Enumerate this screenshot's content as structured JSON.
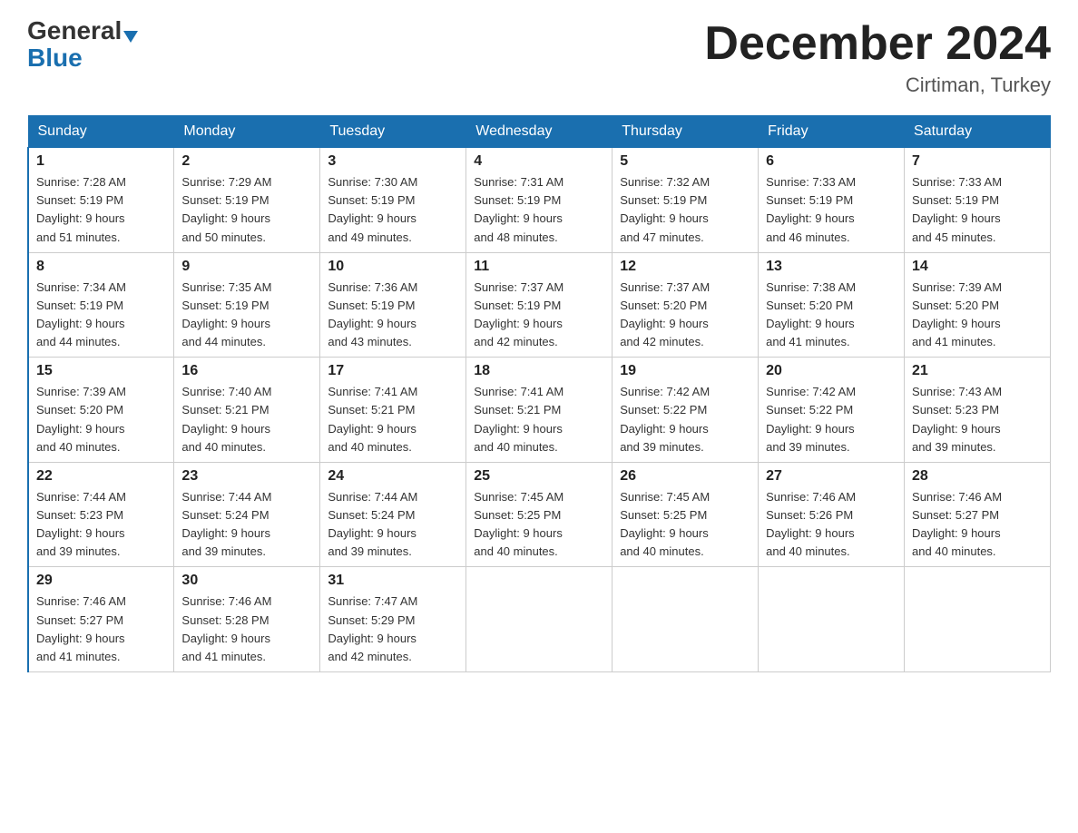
{
  "header": {
    "logo_general": "General",
    "logo_blue": "Blue",
    "month_title": "December 2024",
    "location": "Cirtiman, Turkey"
  },
  "weekdays": [
    "Sunday",
    "Monday",
    "Tuesday",
    "Wednesday",
    "Thursday",
    "Friday",
    "Saturday"
  ],
  "weeks": [
    [
      {
        "day": "1",
        "sunrise": "7:28 AM",
        "sunset": "5:19 PM",
        "daylight": "9 hours and 51 minutes."
      },
      {
        "day": "2",
        "sunrise": "7:29 AM",
        "sunset": "5:19 PM",
        "daylight": "9 hours and 50 minutes."
      },
      {
        "day": "3",
        "sunrise": "7:30 AM",
        "sunset": "5:19 PM",
        "daylight": "9 hours and 49 minutes."
      },
      {
        "day": "4",
        "sunrise": "7:31 AM",
        "sunset": "5:19 PM",
        "daylight": "9 hours and 48 minutes."
      },
      {
        "day": "5",
        "sunrise": "7:32 AM",
        "sunset": "5:19 PM",
        "daylight": "9 hours and 47 minutes."
      },
      {
        "day": "6",
        "sunrise": "7:33 AM",
        "sunset": "5:19 PM",
        "daylight": "9 hours and 46 minutes."
      },
      {
        "day": "7",
        "sunrise": "7:33 AM",
        "sunset": "5:19 PM",
        "daylight": "9 hours and 45 minutes."
      }
    ],
    [
      {
        "day": "8",
        "sunrise": "7:34 AM",
        "sunset": "5:19 PM",
        "daylight": "9 hours and 44 minutes."
      },
      {
        "day": "9",
        "sunrise": "7:35 AM",
        "sunset": "5:19 PM",
        "daylight": "9 hours and 44 minutes."
      },
      {
        "day": "10",
        "sunrise": "7:36 AM",
        "sunset": "5:19 PM",
        "daylight": "9 hours and 43 minutes."
      },
      {
        "day": "11",
        "sunrise": "7:37 AM",
        "sunset": "5:19 PM",
        "daylight": "9 hours and 42 minutes."
      },
      {
        "day": "12",
        "sunrise": "7:37 AM",
        "sunset": "5:20 PM",
        "daylight": "9 hours and 42 minutes."
      },
      {
        "day": "13",
        "sunrise": "7:38 AM",
        "sunset": "5:20 PM",
        "daylight": "9 hours and 41 minutes."
      },
      {
        "day": "14",
        "sunrise": "7:39 AM",
        "sunset": "5:20 PM",
        "daylight": "9 hours and 41 minutes."
      }
    ],
    [
      {
        "day": "15",
        "sunrise": "7:39 AM",
        "sunset": "5:20 PM",
        "daylight": "9 hours and 40 minutes."
      },
      {
        "day": "16",
        "sunrise": "7:40 AM",
        "sunset": "5:21 PM",
        "daylight": "9 hours and 40 minutes."
      },
      {
        "day": "17",
        "sunrise": "7:41 AM",
        "sunset": "5:21 PM",
        "daylight": "9 hours and 40 minutes."
      },
      {
        "day": "18",
        "sunrise": "7:41 AM",
        "sunset": "5:21 PM",
        "daylight": "9 hours and 40 minutes."
      },
      {
        "day": "19",
        "sunrise": "7:42 AM",
        "sunset": "5:22 PM",
        "daylight": "9 hours and 39 minutes."
      },
      {
        "day": "20",
        "sunrise": "7:42 AM",
        "sunset": "5:22 PM",
        "daylight": "9 hours and 39 minutes."
      },
      {
        "day": "21",
        "sunrise": "7:43 AM",
        "sunset": "5:23 PM",
        "daylight": "9 hours and 39 minutes."
      }
    ],
    [
      {
        "day": "22",
        "sunrise": "7:44 AM",
        "sunset": "5:23 PM",
        "daylight": "9 hours and 39 minutes."
      },
      {
        "day": "23",
        "sunrise": "7:44 AM",
        "sunset": "5:24 PM",
        "daylight": "9 hours and 39 minutes."
      },
      {
        "day": "24",
        "sunrise": "7:44 AM",
        "sunset": "5:24 PM",
        "daylight": "9 hours and 39 minutes."
      },
      {
        "day": "25",
        "sunrise": "7:45 AM",
        "sunset": "5:25 PM",
        "daylight": "9 hours and 40 minutes."
      },
      {
        "day": "26",
        "sunrise": "7:45 AM",
        "sunset": "5:25 PM",
        "daylight": "9 hours and 40 minutes."
      },
      {
        "day": "27",
        "sunrise": "7:46 AM",
        "sunset": "5:26 PM",
        "daylight": "9 hours and 40 minutes."
      },
      {
        "day": "28",
        "sunrise": "7:46 AM",
        "sunset": "5:27 PM",
        "daylight": "9 hours and 40 minutes."
      }
    ],
    [
      {
        "day": "29",
        "sunrise": "7:46 AM",
        "sunset": "5:27 PM",
        "daylight": "9 hours and 41 minutes."
      },
      {
        "day": "30",
        "sunrise": "7:46 AM",
        "sunset": "5:28 PM",
        "daylight": "9 hours and 41 minutes."
      },
      {
        "day": "31",
        "sunrise": "7:47 AM",
        "sunset": "5:29 PM",
        "daylight": "9 hours and 42 minutes."
      },
      null,
      null,
      null,
      null
    ]
  ],
  "labels": {
    "sunrise": "Sunrise:",
    "sunset": "Sunset:",
    "daylight": "Daylight:"
  }
}
